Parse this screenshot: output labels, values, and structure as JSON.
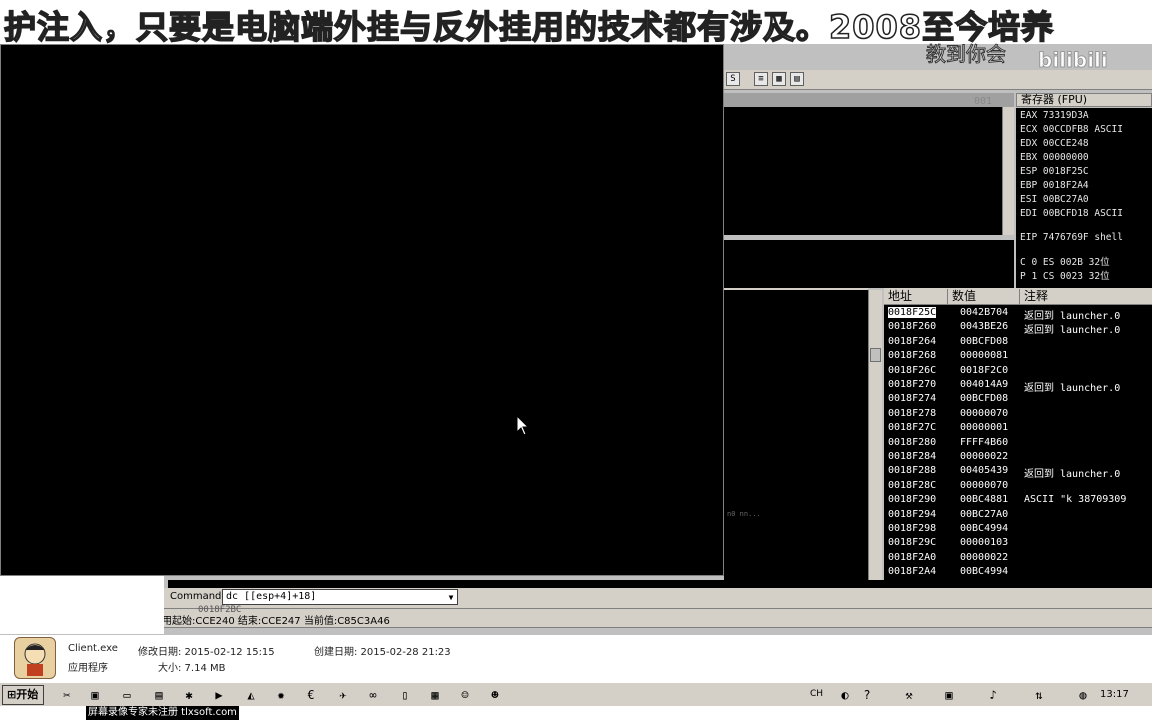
{
  "banner": {
    "text": "护注入，只要是电脑端外挂与反外挂用的技术都有涉及。2008至今培养",
    "subtext": "教到你会",
    "watermark": "bilibili"
  },
  "debugger": {
    "toolbar_buttons": [
      "S",
      "≡",
      "▦",
      "▤"
    ],
    "disasm_addr": "001",
    "registers_title": "寄存器 (FPU)",
    "registers": [
      "EAX 73319D3A",
      "ECX 00CCDFB8 ASCII",
      "EDX 00CCE248",
      "EBX 00000000",
      "ESP 0018F25C",
      "EBP 0018F2A4",
      "ESI 00BC27A0",
      "EDI 00BCFD18 ASCII",
      "EIP 7476769F shell",
      "C 0   ES 002B 32位",
      "P 1   CS 0023 32位"
    ],
    "stack_headers": {
      "address": "地址",
      "value": "数值",
      "comment": "注释"
    },
    "stack_rows": [
      {
        "address": "0018F25C",
        "value": "0042B704",
        "comment": "返回到 launcher.0"
      },
      {
        "address": "0018F260",
        "value": "0043BE26",
        "comment": "返回到 launcher.0"
      },
      {
        "address": "0018F264",
        "value": "00BCFD08",
        "comment": ""
      },
      {
        "address": "0018F268",
        "value": "00000081",
        "comment": ""
      },
      {
        "address": "0018F26C",
        "value": "0018F2C0",
        "comment": ""
      },
      {
        "address": "0018F270",
        "value": "004014A9",
        "comment": "返回到 launcher.0"
      },
      {
        "address": "0018F274",
        "value": "00BCFD08",
        "comment": ""
      },
      {
        "address": "0018F278",
        "value": "00000070",
        "comment": ""
      },
      {
        "address": "0018F27C",
        "value": "00000001",
        "comment": ""
      },
      {
        "address": "0018F280",
        "value": "FFFF4B60",
        "comment": ""
      },
      {
        "address": "0018F284",
        "value": "00000022",
        "comment": ""
      },
      {
        "address": "0018F288",
        "value": "00405439",
        "comment": "返回到 launcher.0"
      },
      {
        "address": "0018F28C",
        "value": "00000070",
        "comment": ""
      },
      {
        "address": "0018F290",
        "value": "00BC4881",
        "comment": "ASCII \"k 38709309"
      },
      {
        "address": "0018F294",
        "value": "00BC27A0",
        "comment": ""
      },
      {
        "address": "0018F298",
        "value": "00BC4994",
        "comment": ""
      },
      {
        "address": "0018F29C",
        "value": "00000103",
        "comment": ""
      },
      {
        "address": "0018F2A0",
        "value": "00000022",
        "comment": ""
      },
      {
        "address": "0018F2A4",
        "value": "00BC4994",
        "comment": ""
      }
    ],
    "mem_stub": "n0 nn..."
  },
  "command": {
    "label": "Command :",
    "value": "dc [[esp+4]+18]",
    "dropdown": "▼"
  },
  "status": {
    "text": "用起始:CCE240 结束:CCE247 当前值:C85C3A46",
    "overlay": "0018F2BC"
  },
  "file_info": {
    "name": "Client.exe",
    "modified_label": "修改日期: 2015-02-12 15:15",
    "created_label": "创建日期: 2015-02-28 21:23",
    "type": "应用程序",
    "size": "大小: 7.14 MB"
  },
  "taskbar": {
    "start": "开始",
    "lang": "CH",
    "clock": "13:17"
  },
  "footer": {
    "watermark": "屏幕录像专家未注册 tlxsoft.com"
  }
}
